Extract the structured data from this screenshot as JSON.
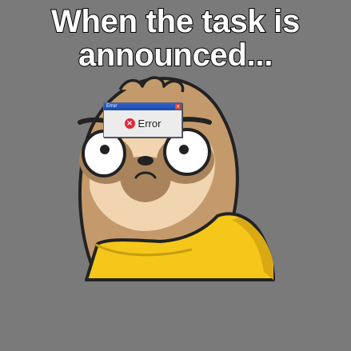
{
  "caption": {
    "line1": "When the task is",
    "line2": "announced..."
  },
  "error_dialog": {
    "title": "Error",
    "message": "Error",
    "close_glyph": "×",
    "icon": "error-x-icon",
    "icon_glyph": "×"
  },
  "colors": {
    "background": "#7a7a7a",
    "sweater": "#f5c71a",
    "fur": "#c49a6c",
    "face": "#f1d4b0",
    "eye_patch": "#a9835b",
    "outline": "#222222",
    "titlebar": "#2f63c9",
    "error_red": "#e0283a"
  }
}
